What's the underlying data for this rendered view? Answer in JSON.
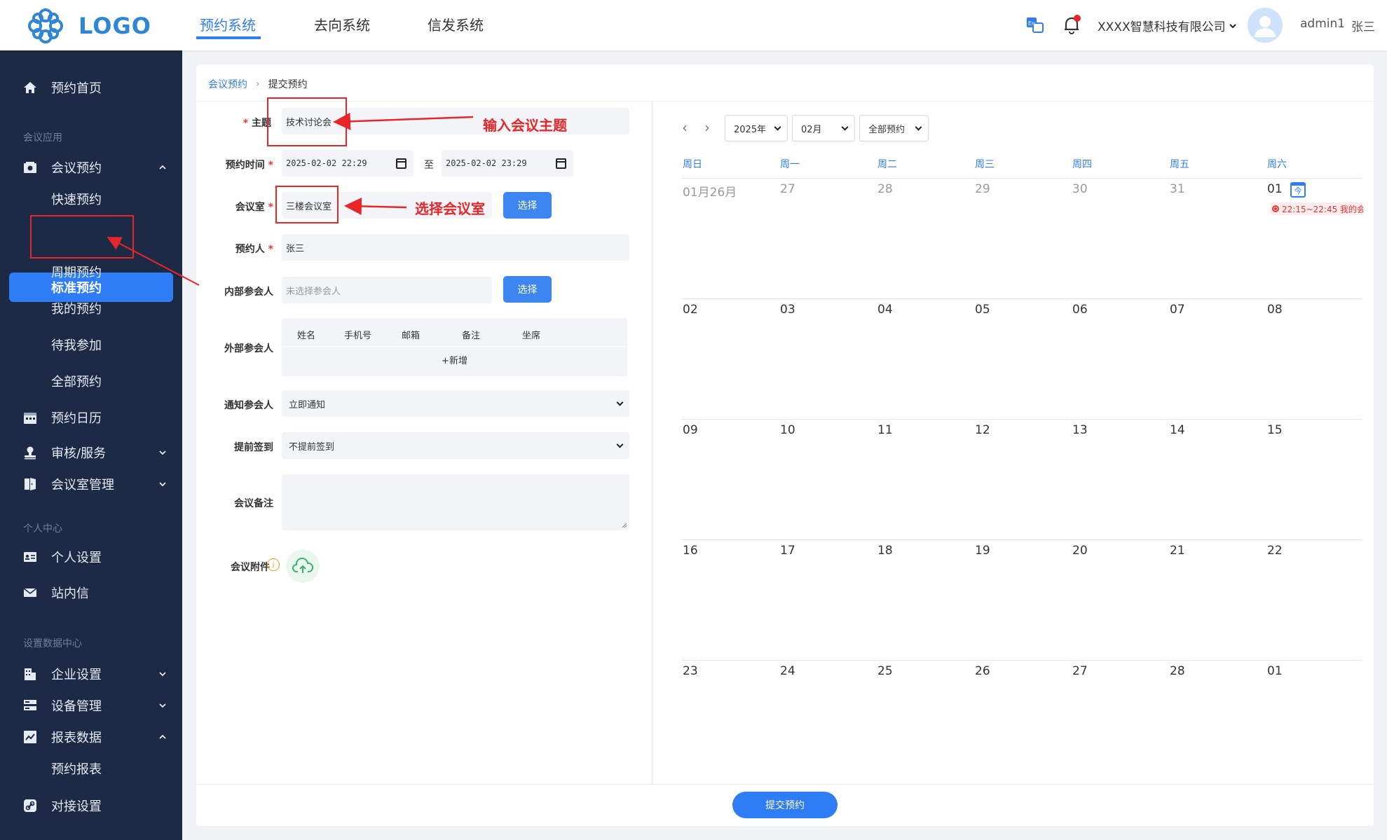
{
  "header": {
    "logo_text": "LOGO",
    "tabs": [
      {
        "label": "预约系统",
        "active": true
      },
      {
        "label": "去向系统",
        "active": false
      },
      {
        "label": "信发系统",
        "active": false
      }
    ],
    "company": "XXXX智慧科技有限公司",
    "username": "admin1",
    "realname": "张三",
    "accent_color": "#2f7df6"
  },
  "sidebar": {
    "home": "预约首页",
    "group_meeting": "会议应用",
    "meeting_booking": "会议预约",
    "quick_booking": "快速预约",
    "standard_booking": "标准预约",
    "recurring_booking": "周期预约",
    "my_booking": "我的预约",
    "pending_join": "待我参加",
    "all_booking": "全部预约",
    "calendar": "预约日历",
    "review_service": "审核/服务",
    "room_manage": "会议室管理",
    "group_personal": "个人中心",
    "personal_settings": "个人设置",
    "inbox": "站内信",
    "group_data": "设置数据中心",
    "enterprise_settings": "企业设置",
    "device_manage": "设备管理",
    "report_data": "报表数据",
    "booking_report": "预约报表",
    "integration": "对接设置"
  },
  "breadcrumb": {
    "parent": "会议预约",
    "current": "提交预约"
  },
  "form": {
    "subject_label": "主题",
    "subject_value": "技术讨论会",
    "time_label": "预约时间",
    "start_time": "2025-02-02 22:29",
    "time_sep": "至",
    "end_time": "2025-02-02 23:29",
    "room_label": "会议室",
    "room_value": "三楼会议室",
    "select_btn": "选择",
    "booker_label": "预约人",
    "booker_value": "张三",
    "internal_label": "内部参会人",
    "internal_placeholder": "未选择参会人",
    "external_label": "外部参会人",
    "external_columns": [
      "姓名",
      "手机号",
      "邮箱",
      "备注",
      "坐席"
    ],
    "external_add": "+新增",
    "notify_label": "通知参会人",
    "notify_value": "立即通知",
    "checkin_label": "提前签到",
    "checkin_value": "不提前签到",
    "remark_label": "会议备注",
    "attach_label": "会议附件",
    "submit": "提交预约"
  },
  "annotations": {
    "subject_hint": "输入会议主题",
    "room_hint": "选择会议室"
  },
  "calendar": {
    "year": "2025年",
    "month": "02月",
    "filter": "全部预约",
    "weekdays": [
      "周日",
      "周一",
      "周二",
      "周三",
      "周四",
      "周五",
      "周六"
    ],
    "weeks": [
      [
        "01月26月",
        "27",
        "28",
        "29",
        "30",
        "31",
        "01"
      ],
      [
        "02",
        "03",
        "04",
        "05",
        "06",
        "07",
        "08"
      ],
      [
        "09",
        "10",
        "11",
        "12",
        "13",
        "14",
        "15"
      ],
      [
        "16",
        "17",
        "18",
        "19",
        "20",
        "21",
        "22"
      ],
      [
        "23",
        "24",
        "25",
        "26",
        "27",
        "28",
        "01"
      ]
    ],
    "today_badge": "今",
    "event": "22:15~22:45 我的会"
  }
}
